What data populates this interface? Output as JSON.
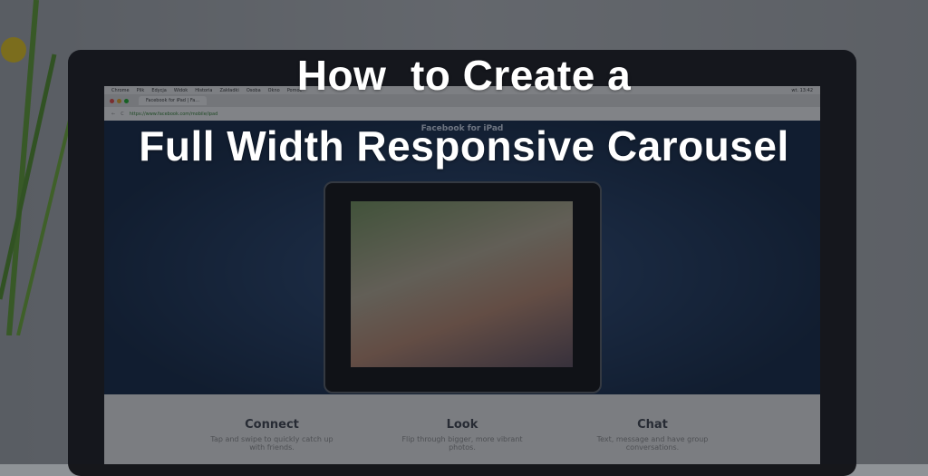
{
  "title": {
    "line1": "How  to Create a",
    "line2": "Full Width Responsive Carousel"
  },
  "browser": {
    "menu": [
      "Chrome",
      "Plik",
      "Edycja",
      "Widok",
      "Historia",
      "Zakładki",
      "Osoba",
      "Okno",
      "Pomoc"
    ],
    "clock": "wt. 13:42",
    "tab_label": "Facebook for iPad | Fa...",
    "url": "https://www.facebook.com/mobile/ipad"
  },
  "page": {
    "heading": "Facebook for iPad",
    "features": [
      {
        "title": "Connect",
        "text": "Tap and swipe to quickly catch up with friends."
      },
      {
        "title": "Look",
        "text": "Flip through bigger, more vibrant photos."
      },
      {
        "title": "Chat",
        "text": "Text, message and have group conversations."
      }
    ]
  }
}
